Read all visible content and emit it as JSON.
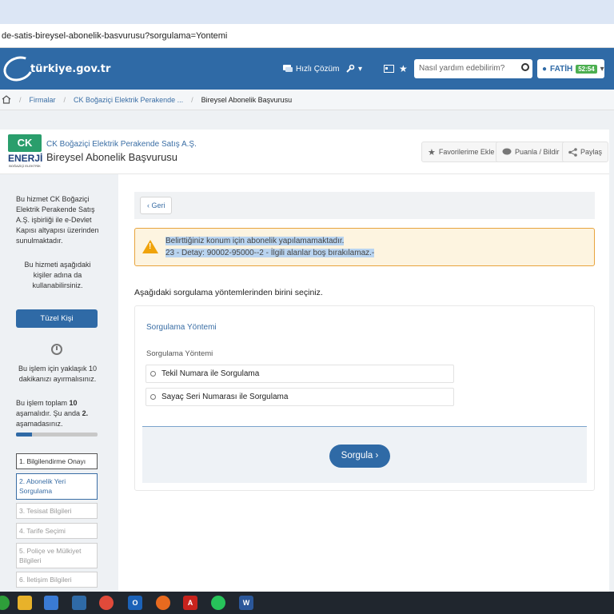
{
  "browser": {
    "url": "de-satis-bireysel-abonelik-basvurusu?sorgulama=Yontemi"
  },
  "header": {
    "logo_text": "türkiye.gov.tr",
    "quick_solution": "Hızlı Çözüm",
    "search_placeholder": "Nasıl yardım edebilirim?",
    "user_name": "FATİH",
    "user_badge": "52:54"
  },
  "breadcrumb": {
    "items": [
      "Firmalar",
      "CK Boğaziçi Elektrik Perakende ...",
      "Bireysel Abonelik Başvurusu"
    ]
  },
  "titlebar": {
    "logo_top": "CK",
    "logo_mid": "ENERJİ",
    "logo_small": "BOĞAZİÇİ ELEKTRİK",
    "company": "CK Boğaziçi Elektrik Perakende Satış A.Ş.",
    "title": "Bireysel Abonelik Başvurusu",
    "favorites": "Favorilerime Ekle",
    "rate": "Puanla / Bildir",
    "share": "Paylaş"
  },
  "sidebar": {
    "intro": "Bu hizmet CK Boğaziçi Elektrik Perakende Satış A.Ş. işbirliği ile e-Devlet Kapısı altyapısı üzerinden sunulmaktadır.",
    "users_text": "Bu hizmeti aşağıdaki kişiler adına da kullanabilirsiniz.",
    "entity_button": "Tüzel Kişi",
    "time_text": "Bu işlem için yaklaşık 10 dakikanızı ayırmalısınız.",
    "steps_text_prefix": "Bu işlem toplam ",
    "steps_total": "10",
    "steps_text_mid": " aşamalıdır. Şu anda ",
    "steps_current": "2.",
    "steps_text_suffix": " aşamadasınız.",
    "progress_fraction": 0.2,
    "steps": [
      "1. Bilgilendirme Onayı",
      "2. Abonelik Yeri Sorgulama",
      "3. Tesisat Bilgileri",
      "4. Tarife Seçimi",
      "5. Poliçe ve Mülkiyet Bilgileri",
      "6. İletişim Bilgileri"
    ]
  },
  "main": {
    "back": "Geri",
    "warning_line1": "Belirttiğiniz konum için abonelik yapılamamaktadır.",
    "warning_line2": "23 - Detay: 90002-95000--2 - İlgili alanlar boş bırakılamaz.-",
    "instruction": "Aşağıdaki sorgulama yöntemlerinden birini seçiniz.",
    "panel_title": "Sorgulama Yöntemi",
    "field_label": "Sorgulama Yöntemi",
    "option1": "Tekil Numara ile Sorgulama",
    "option2": "Sayaç Seri Numarası ile Sorgulama",
    "submit": "Sorgula"
  },
  "taskbar": {
    "icons": [
      "file-explorer-icon",
      "store-icon",
      "mail-icon",
      "chrome-icon",
      "outlook-icon",
      "firefox-icon",
      "acrobat-icon",
      "whatsapp-icon",
      "word-icon"
    ]
  },
  "colors": {
    "brand_blue": "#2f6aa6",
    "warning_border": "#e8a33c",
    "ck_green": "#2a9e6c"
  }
}
